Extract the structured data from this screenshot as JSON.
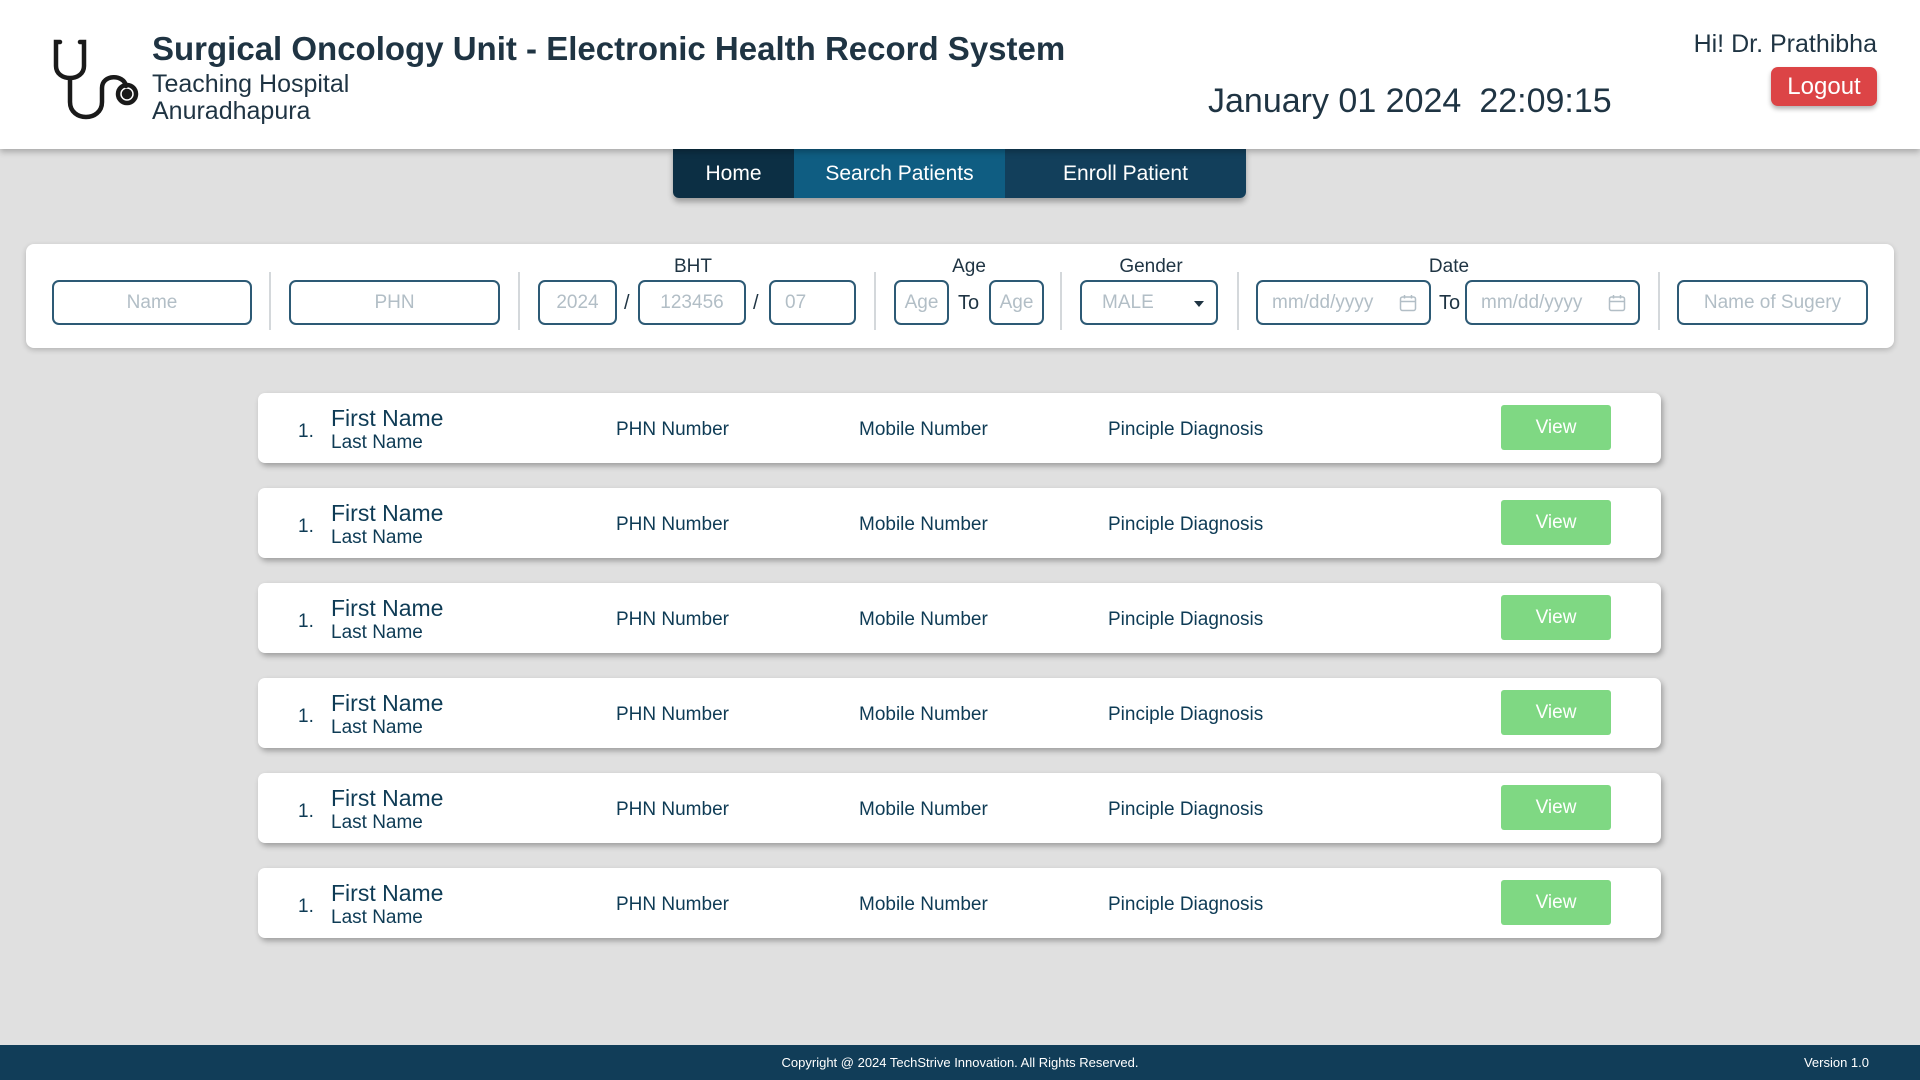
{
  "header": {
    "title": "Surgical Oncology Unit - Electronic Health Record System",
    "subtitle_line1": "Teaching Hospital",
    "subtitle_line2": "Anuradhapura",
    "date": "January 01 2024",
    "time": "22:09:15",
    "greeting": "Hi! Dr. Prathibha",
    "logout_label": "Logout",
    "logo_icon": "stethoscope-icon"
  },
  "nav": {
    "tabs": [
      {
        "label": "Home"
      },
      {
        "label": "Search Patients",
        "active": true
      },
      {
        "label": "Enroll Patient"
      }
    ]
  },
  "filters": {
    "name_placeholder": "Name",
    "phn_placeholder": "PHN",
    "bht_label": "BHT",
    "bht_year_placeholder": "2024",
    "bht_number_placeholder": "123456",
    "bht_month_placeholder": "07",
    "bht_separator": "/",
    "age_label": "Age",
    "age_from_placeholder": "Age",
    "age_to_placeholder": "Age",
    "to_text": "To",
    "gender_label": "Gender",
    "gender_selected": "MALE",
    "date_label": "Date",
    "date_from_placeholder": "mm/dd/yyyy",
    "date_to_placeholder": "mm/dd/yyyy",
    "surgery_placeholder": "Name of Sugery"
  },
  "patients": [
    {
      "index": "1.",
      "first_name": "First Name",
      "last_name": "Last Name",
      "phn": "PHN Number",
      "mobile": "Mobile Number",
      "diagnosis": "Pinciple Diagnosis",
      "view_label": "View"
    },
    {
      "index": "1.",
      "first_name": "First Name",
      "last_name": "Last Name",
      "phn": "PHN Number",
      "mobile": "Mobile Number",
      "diagnosis": "Pinciple Diagnosis",
      "view_label": "View"
    },
    {
      "index": "1.",
      "first_name": "First Name",
      "last_name": "Last Name",
      "phn": "PHN Number",
      "mobile": "Mobile Number",
      "diagnosis": "Pinciple Diagnosis",
      "view_label": "View"
    },
    {
      "index": "1.",
      "first_name": "First Name",
      "last_name": "Last Name",
      "phn": "PHN Number",
      "mobile": "Mobile Number",
      "diagnosis": "Pinciple Diagnosis",
      "view_label": "View"
    },
    {
      "index": "1.",
      "first_name": "First Name",
      "last_name": "Last Name",
      "phn": "PHN Number",
      "mobile": "Mobile Number",
      "diagnosis": "Pinciple Diagnosis",
      "view_label": "View"
    },
    {
      "index": "1.",
      "first_name": "First Name",
      "last_name": "Last Name",
      "phn": "PHN Number",
      "mobile": "Mobile Number",
      "diagnosis": "Pinciple Diagnosis",
      "view_label": "View"
    }
  ],
  "footer": {
    "copyright": "Copyright @ 2024 TechStrive Innovation. All Rights Reserved.",
    "version": "Version 1.0"
  },
  "colors": {
    "header_bg": "#ffffff",
    "page_bg": "#e0e0e0",
    "nav_active": "#0f5d82",
    "nav_dark": "#0c2f44",
    "logout_red": "#dc4446",
    "view_green": "#7fd883",
    "footer_bg": "#113d58",
    "text_dark": "#1f3443"
  }
}
